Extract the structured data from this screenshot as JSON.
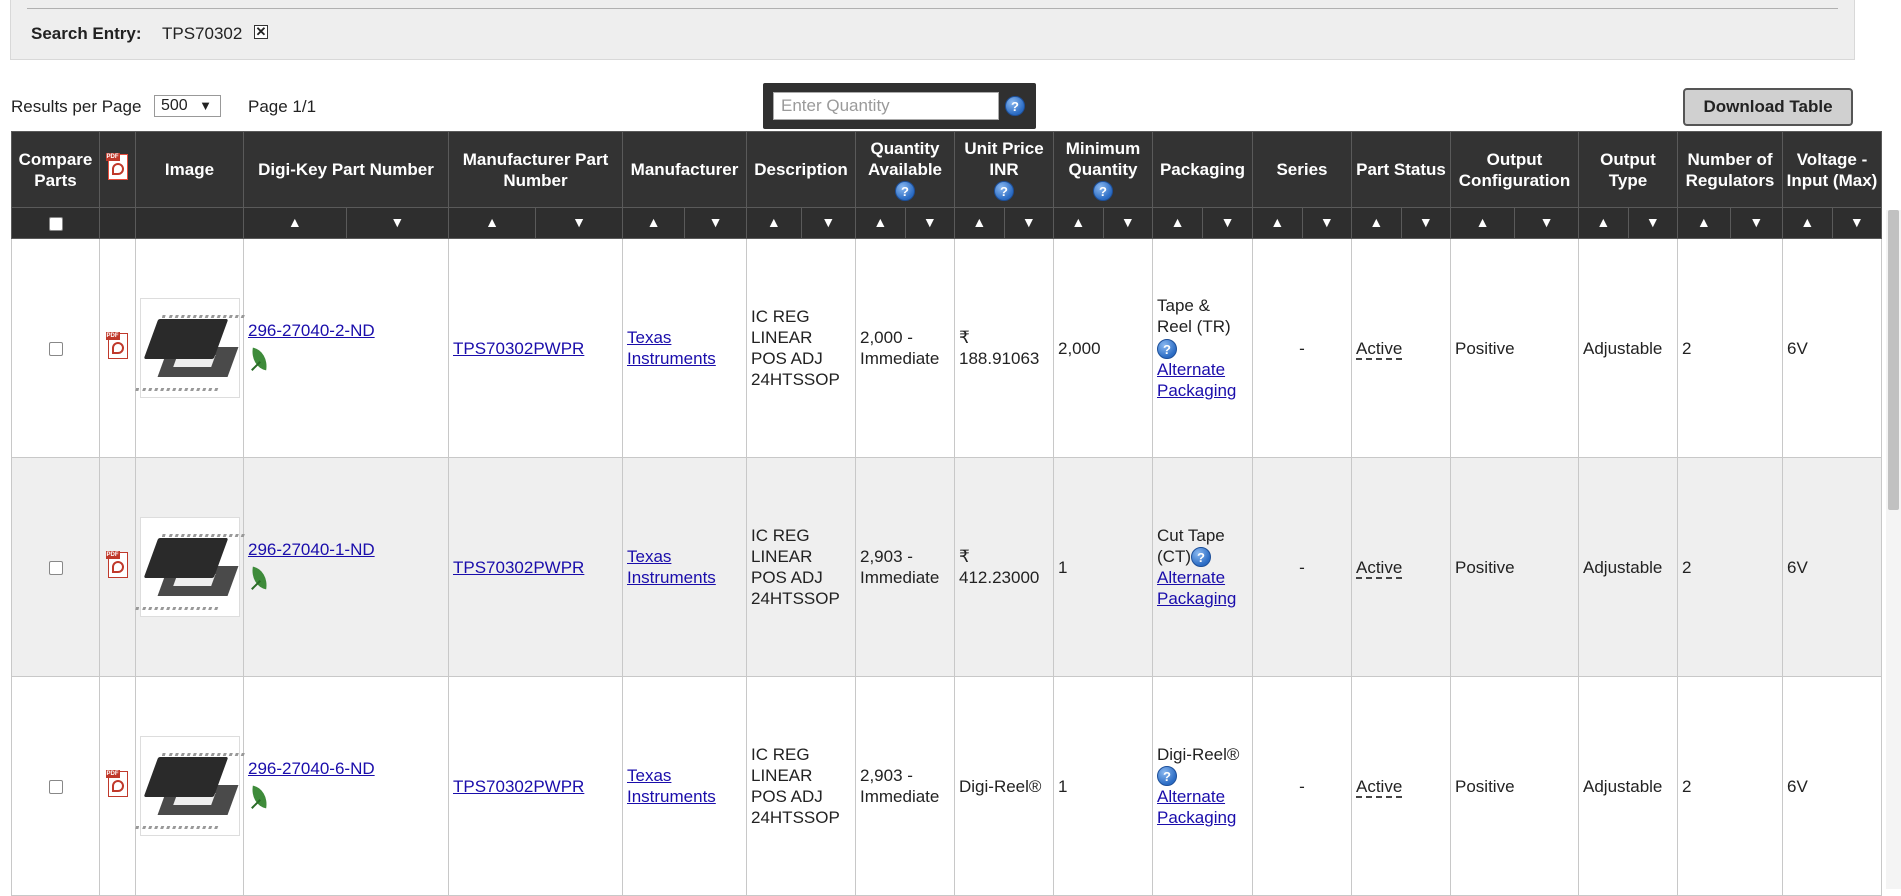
{
  "search": {
    "label": "Search Entry:",
    "value": "TPS70302",
    "remove": "✕"
  },
  "pagination": {
    "rpp_label": "Results per Page",
    "rpp_value": "500",
    "rpp_arrow": "▼",
    "page": "Page 1/1"
  },
  "quantity": {
    "placeholder": "Enter Quantity",
    "help": "?"
  },
  "download_label": "Download Table",
  "headers": {
    "compare": "Compare Parts",
    "image": "Image",
    "digikey_pn": "Digi-Key Part Number",
    "mfr_pn": "Manufacturer Part Number",
    "manufacturer": "Manufacturer",
    "description": "Description",
    "qty_available": "Quantity Available",
    "unit_price": "Unit Price INR",
    "min_qty": "Minimum Quantity",
    "packaging": "Packaging",
    "series": "Series",
    "part_status": "Part Status",
    "output_config": "Output Configuration",
    "output_type": "Output Type",
    "num_regulators": "Number of Regulators",
    "voltage_input_max": "Voltage - Input (Max)"
  },
  "sort": {
    "asc": "▲",
    "desc": "▼"
  },
  "help_glyph": "?",
  "rows": [
    {
      "digikey_pn": "296-27040-2-ND",
      "mfr_pn": "TPS70302PWPR",
      "manufacturer": "Texas Instruments",
      "description": "IC REG LINEAR POS ADJ 24HTSSOP",
      "qty_available": "2,000 - Immediate",
      "unit_price": "₹ 188.91063",
      "min_qty": "2,000",
      "packaging": "Tape & Reel (TR)",
      "alt_packaging": "Alternate Packaging",
      "series": "-",
      "part_status": "Active",
      "output_config": "Positive",
      "output_type": "Adjustable",
      "num_regulators": "2",
      "voltage_input_max": "6V"
    },
    {
      "digikey_pn": "296-27040-1-ND",
      "mfr_pn": "TPS70302PWPR",
      "manufacturer": "Texas Instruments",
      "description": "IC REG LINEAR POS ADJ 24HTSSOP",
      "qty_available": "2,903 - Immediate",
      "unit_price": "₹ 412.23000",
      "min_qty": "1",
      "packaging": "Cut Tape (CT)",
      "alt_packaging": "Alternate Packaging",
      "series": "-",
      "part_status": "Active",
      "output_config": "Positive",
      "output_type": "Adjustable",
      "num_regulators": "2",
      "voltage_input_max": "6V"
    },
    {
      "digikey_pn": "296-27040-6-ND",
      "mfr_pn": "TPS70302PWPR",
      "manufacturer": "Texas Instruments",
      "description": "IC REG LINEAR POS ADJ 24HTSSOP",
      "qty_available": "2,903 - Immediate",
      "unit_price": "Digi-Reel®",
      "min_qty": "1",
      "packaging": "Digi-Reel®",
      "alt_packaging": "Alternate Packaging",
      "series": "-",
      "part_status": "Active",
      "output_config": "Positive",
      "output_type": "Adjustable",
      "num_regulators": "2",
      "voltage_input_max": "6V"
    }
  ]
}
